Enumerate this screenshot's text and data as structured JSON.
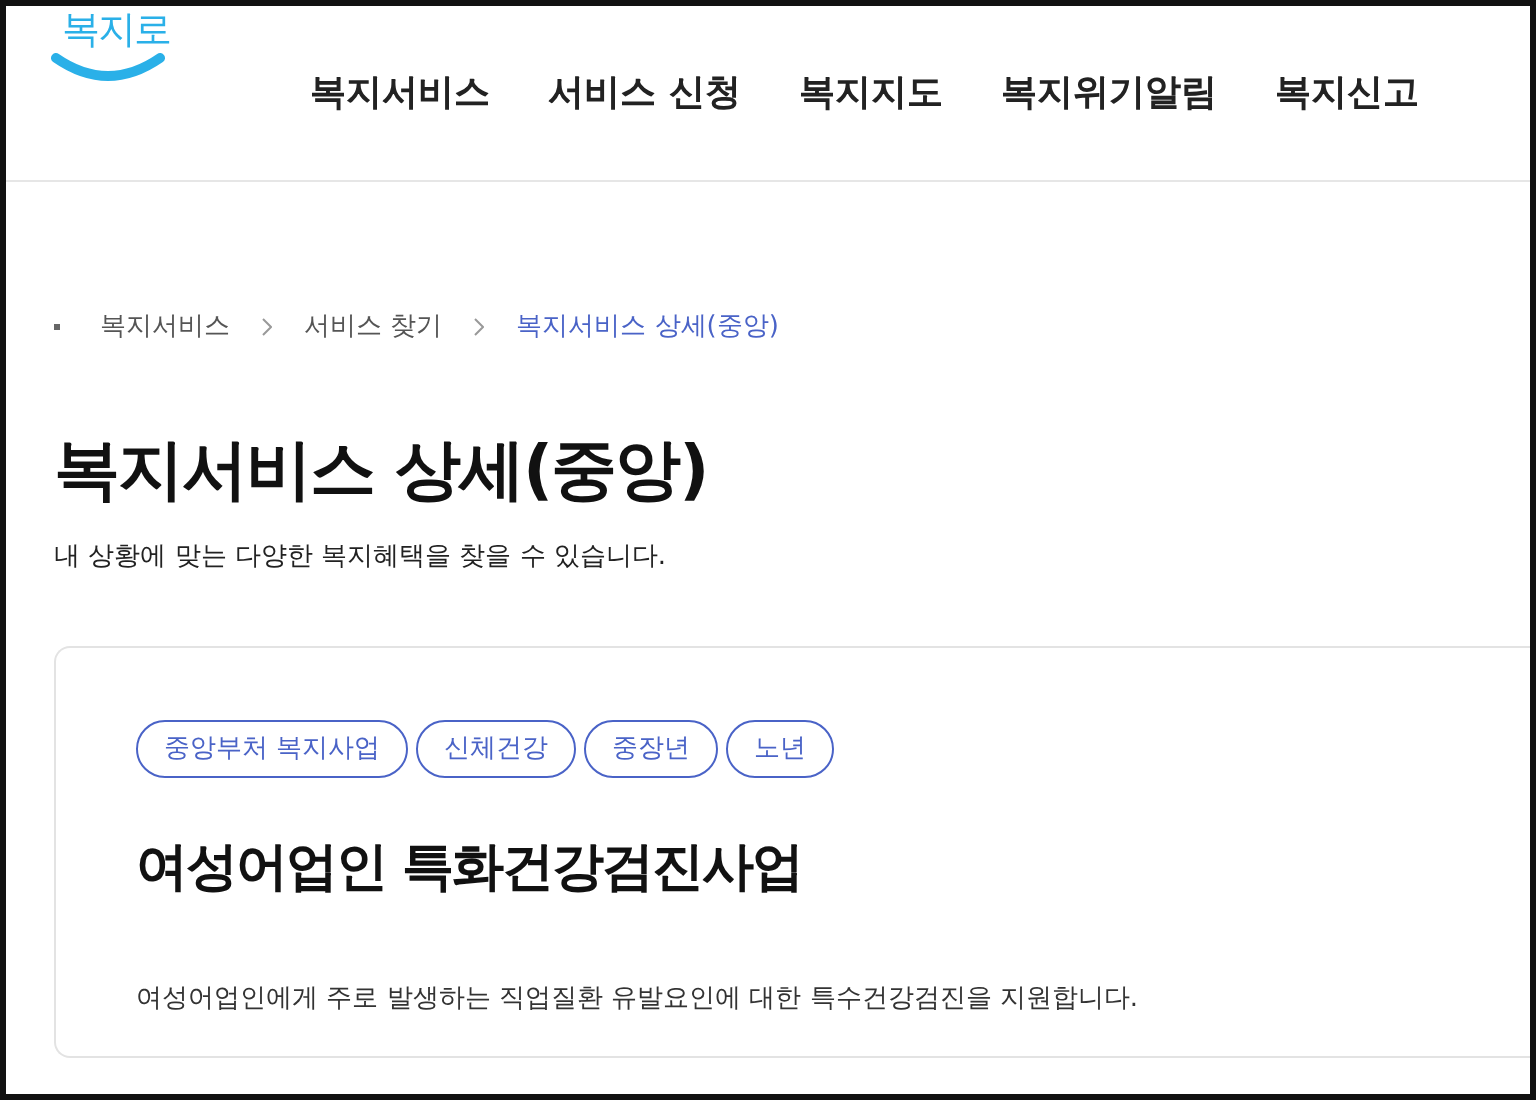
{
  "logo": {
    "text": "복지로"
  },
  "nav": [
    {
      "label": "복지서비스"
    },
    {
      "label": "서비스 신청"
    },
    {
      "label": "복지지도"
    },
    {
      "label": "복지위기알림"
    },
    {
      "label": "복지신고"
    }
  ],
  "breadcrumb": [
    {
      "label": "복지서비스",
      "current": false
    },
    {
      "label": "서비스 찾기",
      "current": false
    },
    {
      "label": "복지서비스 상세(중앙)",
      "current": true
    }
  ],
  "page": {
    "title": "복지서비스 상세(중앙)",
    "subtitle": "내 상황에 맞는 다양한 복지혜택을 찾을 수 있습니다."
  },
  "service": {
    "tags": [
      "중앙부처 복지사업",
      "신체건강",
      "중장년",
      "노년"
    ],
    "title": "여성어업인 특화건강검진사업",
    "description": "여성어업인에게 주로 발생하는 직업질환 유발요인에 대한 특수건강검진을 지원합니다."
  }
}
